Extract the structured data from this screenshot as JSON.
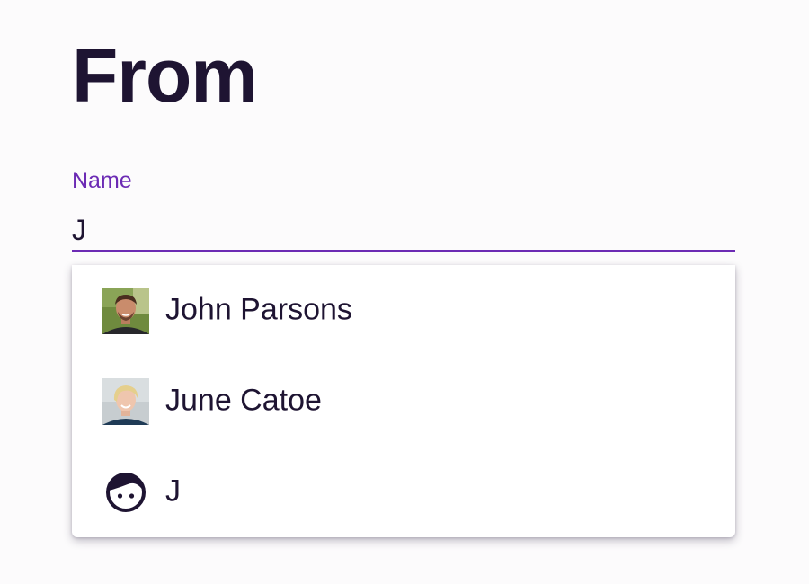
{
  "heading": "From",
  "name_field": {
    "label": "Name",
    "value": "J"
  },
  "suggestions": [
    {
      "name": "John Parsons",
      "avatar": "john-parsons-photo"
    },
    {
      "name": "June Catoe",
      "avatar": "june-catoe-photo"
    },
    {
      "name": "J",
      "avatar": "person-face-icon"
    }
  ],
  "colors": {
    "accent": "#6c2bb4",
    "text": "#1e1432",
    "background": "#fcfbfc",
    "menu_background": "#ffffff"
  }
}
